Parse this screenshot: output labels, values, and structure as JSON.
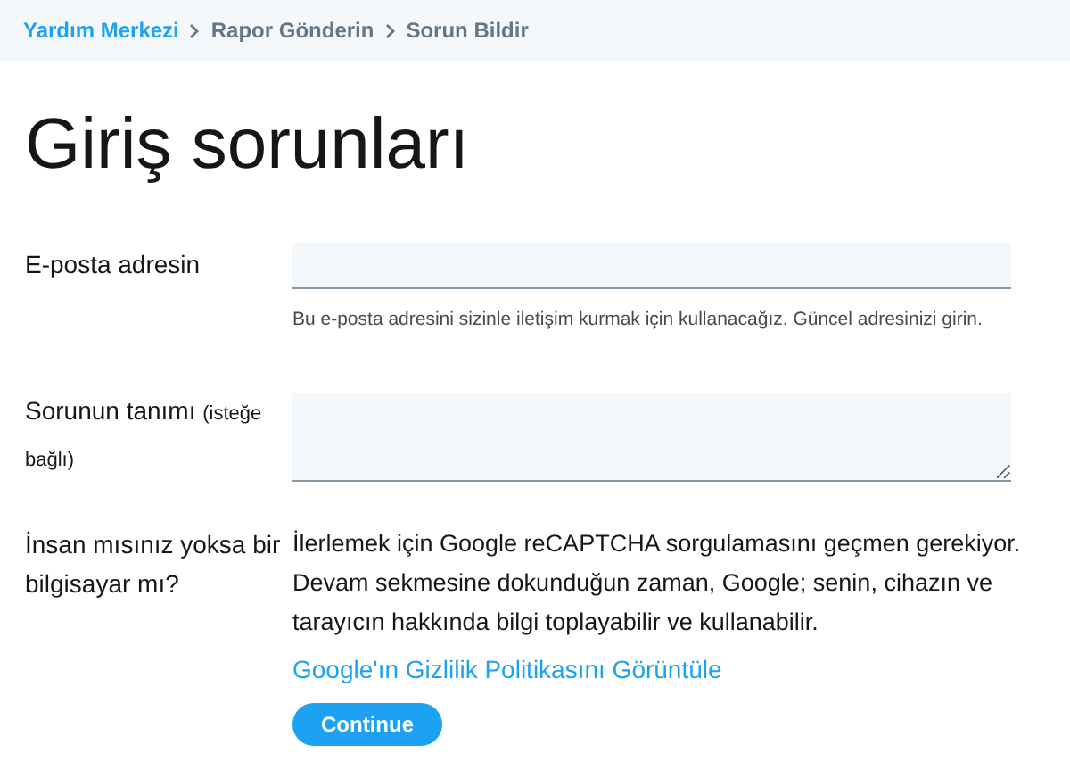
{
  "breadcrumb": [
    {
      "label": "Yardım Merkezi",
      "kind": "link"
    },
    {
      "label": "Rapor Gönderin",
      "kind": "text"
    },
    {
      "label": "Sorun Bildir",
      "kind": "text"
    }
  ],
  "title": "Giriş sorunları",
  "email": {
    "label": "E-posta adresin",
    "help": "Bu e-posta adresini sizinle iletişim kurmak için kullanacağız. Güncel adresinizi girin."
  },
  "description": {
    "label": "Sorunun tanımı",
    "note": "(isteğe bağlı)"
  },
  "captcha": {
    "label": "İnsan mısınız yoksa bir bilgisayar mı?",
    "text": "İlerlemek için Google reCAPTCHA sorgulamasını geçmen gerekiyor. Devam sekmesine dokunduğun zaman, Google; senin, cihazın ve tarayıcın hakkında bilgi toplayabilir ve kullanabilir.",
    "link": "Google'ın Gizlilik Politikasını Görüntüle",
    "button": "Continue"
  }
}
